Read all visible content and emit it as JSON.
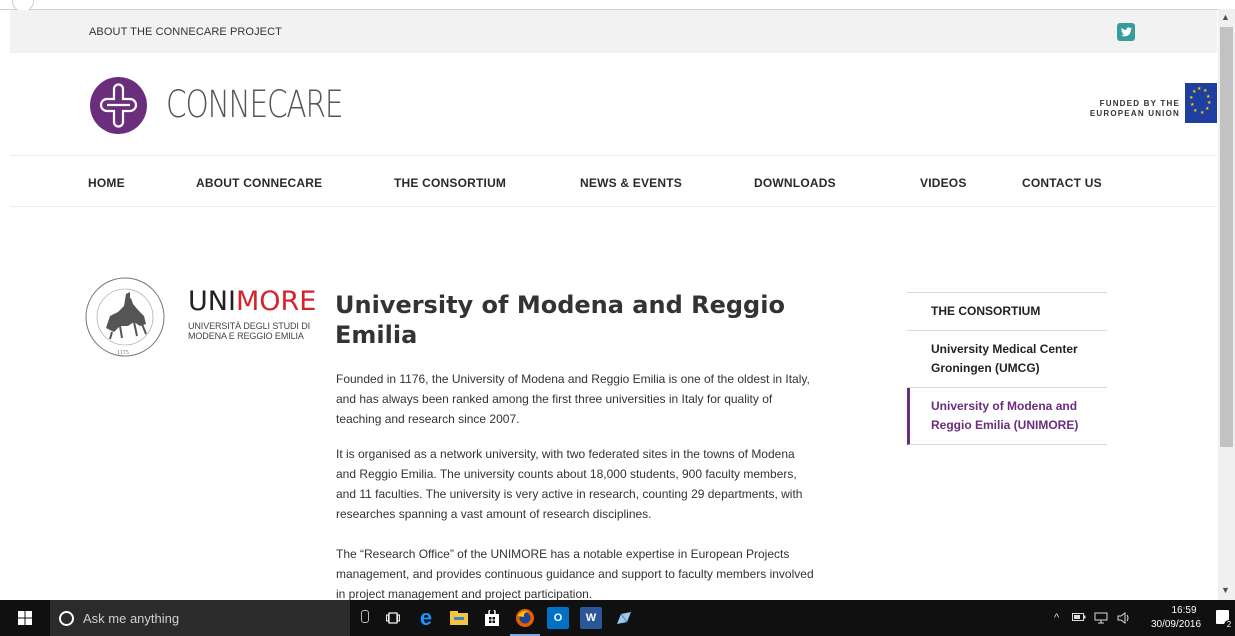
{
  "topbar": {
    "about_link": "ABOUT THE CONNECARE PROJECT"
  },
  "header": {
    "logo_text": "CONNECARE",
    "eu_line1": "FUNDED BY THE",
    "eu_line2": "EUROPEAN UNION"
  },
  "nav": {
    "items": [
      {
        "label": "HOME"
      },
      {
        "label": "ABOUT CONNECARE"
      },
      {
        "label": "THE CONSORTIUM"
      },
      {
        "label": "NEWS & EVENTS"
      },
      {
        "label": "DOWNLOADS"
      },
      {
        "label": "VIDEOS"
      },
      {
        "label": "CONTACT US"
      }
    ]
  },
  "partner_logo": {
    "word_uni": "UNI",
    "word_more": "MORE",
    "sub1": "UNIVERSITÀ DEGLI STUDI DI",
    "sub2": "MODENA E REGGIO EMILIA",
    "seal_year": "1175"
  },
  "main": {
    "title": "University of Modena and Reggio Emilia",
    "paragraphs": [
      "Founded in 1176, the University of Modena and Reggio Emilia is one of the oldest in Italy, and has always been ranked among the first three universities in Italy for quality of teaching and research since 2007.",
      "It is organised as a network university, with two federated sites in the towns of Modena and Reggio Emilia. The university counts about 18,000 students, 900 faculty members, and 11 faculties. The university is very active in research, counting 29 departments, with researches spanning a vast amount of research disciplines.",
      "The “Research Office” of the UNIMORE has a notable expertise in European Projects management, and provides continuous guidance and support to faculty members involved in project management and project participation."
    ]
  },
  "sidebar": {
    "heading": "THE CONSORTIUM",
    "items": [
      {
        "label": "University Medical Center Groningen (UMCG)",
        "active": false
      },
      {
        "label": "University of Modena and Reggio Emilia (UNIMORE)",
        "active": true
      }
    ]
  },
  "taskbar": {
    "search_placeholder": "Ask me anything",
    "time": "16:59",
    "date": "30/09/2016",
    "notification_count": "2"
  },
  "colors": {
    "brand_purple": "#6b2e7c",
    "unimore_red": "#d6232a",
    "twitter_teal": "#3a9b9b",
    "eu_blue": "#1f3fa0"
  }
}
